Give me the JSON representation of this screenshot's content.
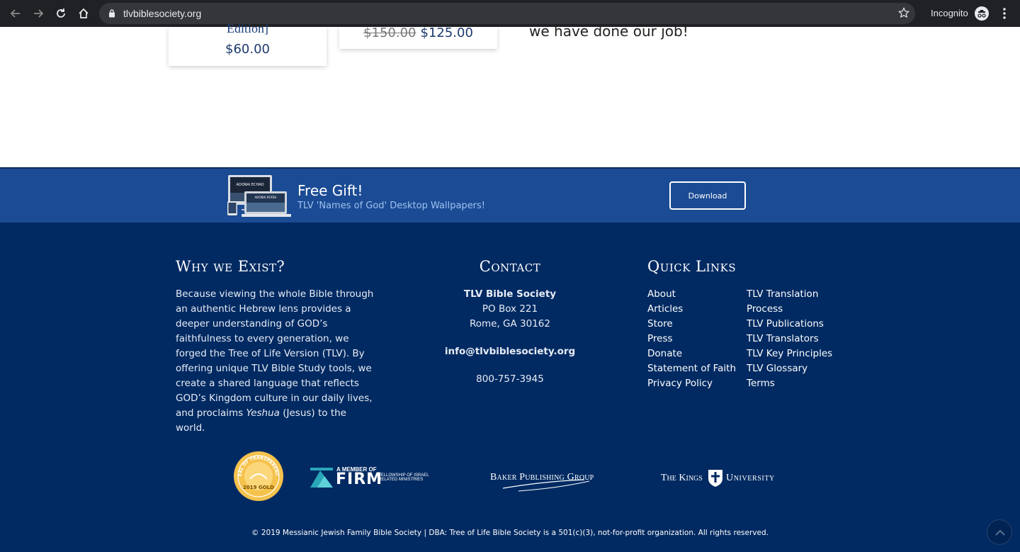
{
  "browser": {
    "url": "tlvbiblesociety.org",
    "incognito_label": "Incognito"
  },
  "products": {
    "card1_title_tail": "Edition]",
    "card1_price": "$60.00",
    "card2_old_price": "$150.00",
    "card2_price": "$125.00",
    "promo_tail": "we have done our job!"
  },
  "gift": {
    "title": "Free Gift!",
    "subtitle": "TLV 'Names of God' Desktop Wallpapers!",
    "button_label": "Download",
    "device_caption": "ADONAI ECHAD",
    "device_caption2": "ADONAI ROFEH"
  },
  "footer": {
    "why": {
      "heading": "Why we Exist?",
      "text_before_em": "Because viewing the whole Bible through an authentic Hebrew lens provides a deeper understanding of GOD’s faithfulness to every generation, we forged the Tree of Life Version (TLV). By offering unique TLV Bible Study tools, we create a shared language that reflects GOD’s Kingdom culture in our daily lives, and proclaims ",
      "em": "Yeshua",
      "text_after_em": " (Jesus) to the world."
    },
    "contact": {
      "heading": "Contact",
      "org": "TLV Bible Society",
      "address1": "PO Box 221",
      "address2": "Rome, GA 30162",
      "email": "info@tlvbiblesociety.org",
      "phone": "800-757-3945"
    },
    "quick_links": {
      "heading": "Quick Links",
      "col1": [
        "About",
        "Articles",
        "Store",
        "Press",
        "Donate",
        "Statement of Faith",
        "Privacy Policy"
      ],
      "col2": [
        "TLV Translation Process",
        "TLV Publications",
        "TLV Translators",
        "TLV Key Principles",
        "TLV Glossary",
        "Terms"
      ]
    },
    "partners": {
      "seal_top": "SEAL OF TRANSPARENCY",
      "seal_year": "2019 GOLD",
      "firm_top": "A MEMBER OF",
      "firm_big": "FIRM",
      "firm_small": "FELLOWSHIP OF ISRAEL RELATED MINISTRIES",
      "baker": "Baker Publishing Group",
      "kings_a": "The Kings",
      "kings_b": "University"
    },
    "copyright": "© 2019 Messianic Jewish Family Bible Society | DBA: Tree of Life Bible Society is a 501(c)(3), not-for-profit organization. All rights reserved."
  },
  "colors": {
    "gift_band": "#1b4b94",
    "footer_bg": "#012a62",
    "price": "#1d3a6d",
    "seal_gold": "#f5c24c"
  }
}
